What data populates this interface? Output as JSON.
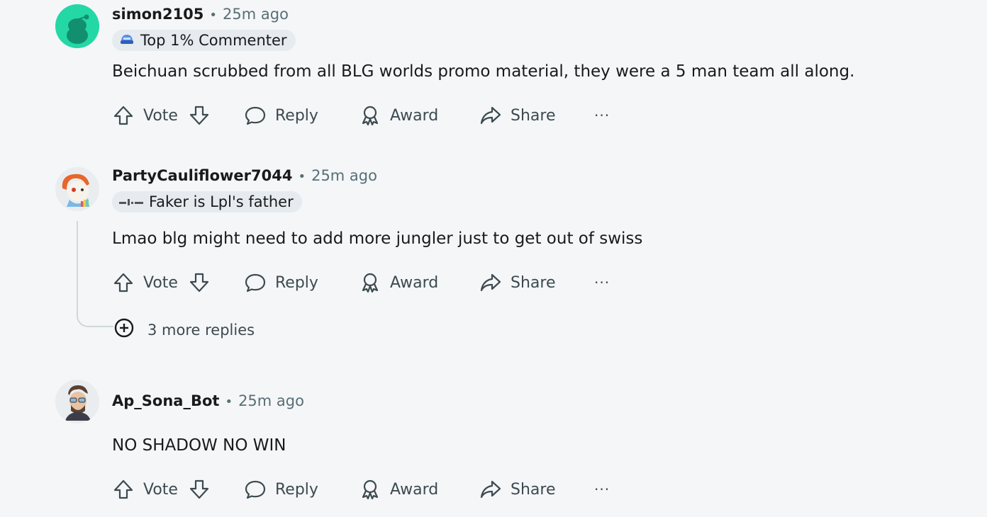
{
  "comments": [
    {
      "username": "simon2105",
      "time": "25m ago",
      "flair": "Top 1% Commenter",
      "body": "Beichuan scrubbed from all BLG worlds promo material, they were a 5 man team all along.",
      "avatar_color": "#24d8a6"
    },
    {
      "username": "PartyCauliflower7044",
      "time": "25m ago",
      "flair": "Faker is Lpl's father",
      "body": "Lmao blg might need to add more jungler just to get out of swiss",
      "more_replies": "3 more replies"
    },
    {
      "username": "Ap_Sona_Bot",
      "time": "25m ago",
      "body": "NO SHADOW NO WIN"
    }
  ],
  "actions": {
    "vote": "Vote",
    "reply": "Reply",
    "award": "Award",
    "share": "Share",
    "more": "···"
  },
  "separator": "•",
  "icons": [
    "upvote-icon",
    "downvote-icon",
    "reply-icon",
    "award-icon",
    "share-icon",
    "more-icon",
    "add-circle-icon"
  ]
}
